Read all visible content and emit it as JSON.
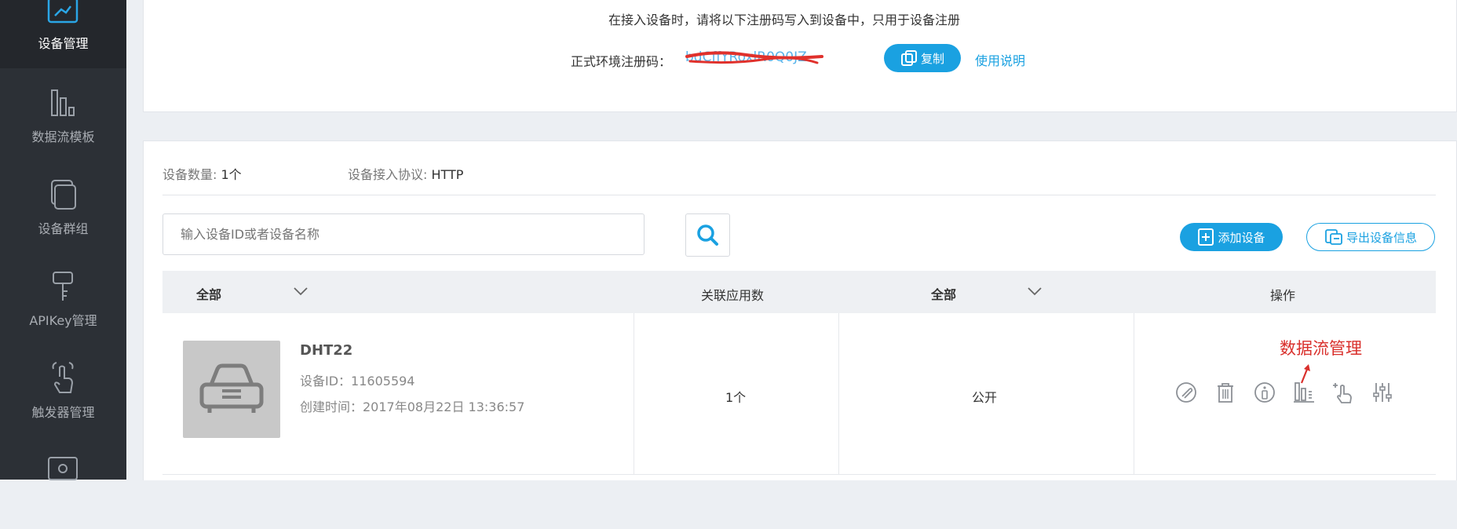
{
  "sidebar": {
    "items": [
      {
        "label": "设备管理",
        "icon": "device-manage-icon",
        "active": true
      },
      {
        "label": "数据流模板",
        "icon": "datastream-template-icon"
      },
      {
        "label": "设备群组",
        "icon": "device-group-icon"
      },
      {
        "label": "APIKey管理",
        "icon": "apikey-icon"
      },
      {
        "label": "触发器管理",
        "icon": "trigger-icon"
      },
      {
        "label": "",
        "icon": "settings-icon"
      }
    ]
  },
  "register": {
    "notice": "在接入设备时，请将以下注册码写入到设备中，只用于设备注册",
    "code_label": "正式环境注册码：",
    "code_value": "bdCffYRoxlR0Q0JZ",
    "copy_label": "复制",
    "help_label": "使用说明"
  },
  "summary": {
    "count_label": "设备数量:",
    "count_value": "1个",
    "protocol_label": "设备接入协议:",
    "protocol_value": "HTTP"
  },
  "search": {
    "placeholder": "输入设备ID或者设备名称"
  },
  "actions": {
    "add_device": "添加设备",
    "export_info": "导出设备信息"
  },
  "table": {
    "headers": {
      "filter1": "全部",
      "apps": "关联应用数",
      "filter2": "全部",
      "ops": "操作"
    },
    "rows": [
      {
        "name": "DHT22",
        "device_id": "设备ID：11605594",
        "created": "创建时间：2017年08月22日 13:36:57",
        "app_count": "1个",
        "visibility": "公开"
      }
    ]
  },
  "annotation": {
    "text": "数据流管理",
    "color": "#d9302c"
  },
  "colors": {
    "accent": "#1aa1e1",
    "sidebar_bg": "#2c3036"
  }
}
